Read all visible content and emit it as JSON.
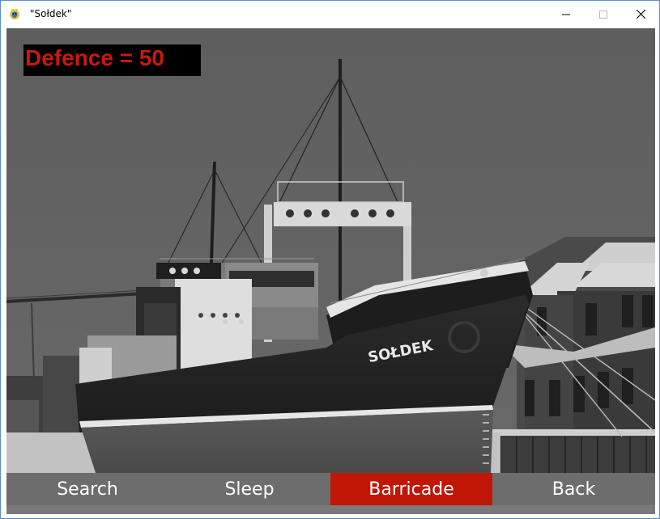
{
  "window": {
    "title": "\"Sołdek\"",
    "icon": "pygame-snake-icon",
    "controls": [
      "minimize-icon",
      "maximize-icon",
      "close-icon"
    ]
  },
  "hud": {
    "defence_label": "Defence = 50",
    "defence_value": 50,
    "text_color": "#c81a0c",
    "box_color": "#000000"
  },
  "scene": {
    "description_icon": "ship-photo",
    "hull_name": "SOŁDEK"
  },
  "menu": {
    "items": [
      {
        "label": "Search",
        "active": false
      },
      {
        "label": "Sleep",
        "active": false
      },
      {
        "label": "Barricade",
        "active": true
      },
      {
        "label": "Back",
        "active": false
      }
    ],
    "button_color": "#6d6d6d",
    "active_color": "#c11606"
  }
}
